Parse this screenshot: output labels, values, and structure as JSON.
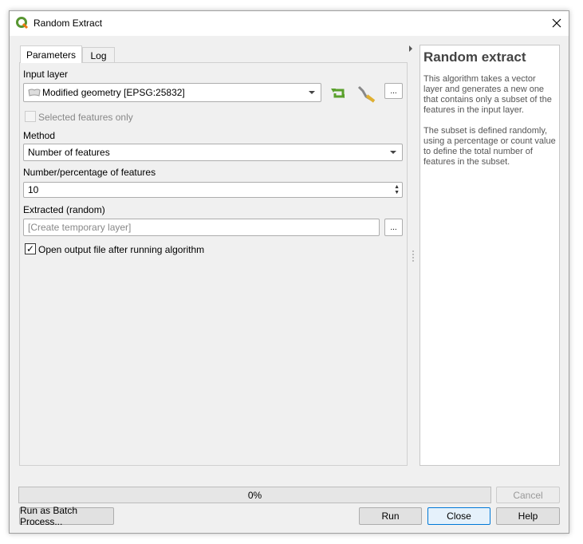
{
  "window": {
    "title": "Random Extract",
    "close_icon": "close-icon"
  },
  "tabs": [
    {
      "label": "Parameters",
      "active": true
    },
    {
      "label": "Log",
      "active": false
    }
  ],
  "params": {
    "input_layer_label": "Input layer",
    "input_layer_value": "Modified geometry [EPSG:25832]",
    "selected_only_label": "Selected features only",
    "selected_only_checked": false,
    "method_label": "Method",
    "method_value": "Number of features",
    "number_label": "Number/percentage of features",
    "number_value": "10",
    "output_label": "Extracted (random)",
    "output_placeholder": "[Create temporary layer]",
    "open_output_label": "Open output file after running algorithm",
    "open_output_checked": true,
    "browse_label": "..."
  },
  "help": {
    "title": "Random extract",
    "p1": "This algorithm takes a vector layer and generates a new one that contains only a subset of the features in the input layer.",
    "p2": "The subset is defined randomly, using a percentage or count value to define the total number of features in the subset."
  },
  "progress": {
    "value": 0,
    "text": "0%"
  },
  "buttons": {
    "cancel": "Cancel",
    "batch": "Run as Batch Process...",
    "run": "Run",
    "close": "Close",
    "help": "Help"
  },
  "colors": {
    "accent": "#0078d7",
    "iterate_icon": "#5aa02c"
  }
}
